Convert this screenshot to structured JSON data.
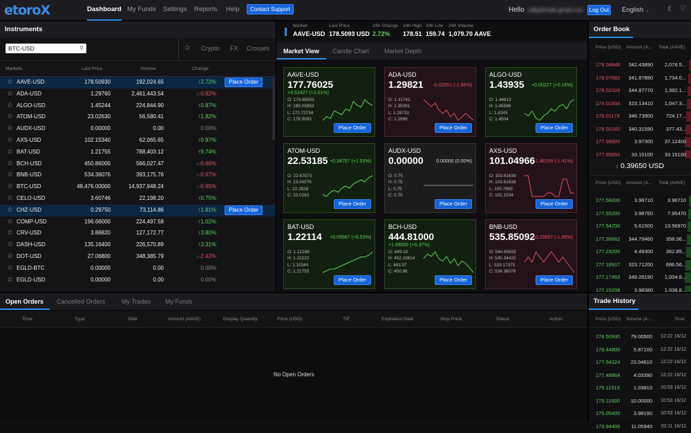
{
  "header": {
    "logo": "etoroX",
    "nav": [
      {
        "label": "Dashboard",
        "active": true
      },
      {
        "label": "My Funds",
        "active": false
      },
      {
        "label": "Settings",
        "active": false
      },
      {
        "label": "Reports",
        "active": false
      },
      {
        "label": "Help",
        "active": false
      }
    ],
    "contact_support": "Contact Support",
    "greeting": "Hello",
    "user_email": "sdfg@trade.gmail.com",
    "logout": "Log Out",
    "language": "English"
  },
  "instruments": {
    "title": "Instruments",
    "search_value": "BTC-USD",
    "filter_tabs": [
      "Crypto",
      "FX",
      "Crosses"
    ],
    "columns": [
      "Markets",
      "Last Price",
      "Volume",
      "Change"
    ],
    "place_order_label": "Place Order",
    "rows": [
      {
        "market": "AAVE-USD",
        "last": "178.50930",
        "volume": "192,024.65",
        "change": "2.72%",
        "dir": "up",
        "selected": true
      },
      {
        "market": "ADA-USD",
        "last": "1.29760",
        "volume": "2,461,443.54",
        "change": "-0.92%",
        "dir": "dn",
        "selected": false
      },
      {
        "market": "ALGO-USD",
        "last": "1.45244",
        "volume": "224,844.90",
        "change": "0.87%",
        "dir": "up",
        "selected": false
      },
      {
        "market": "ATOM-USD",
        "last": "23.02630",
        "volume": "56,580.41",
        "change": "1.82%",
        "dir": "up",
        "selected": false
      },
      {
        "market": "AUDX-USD",
        "last": "0.00000",
        "volume": "0.00",
        "change": "0.00%",
        "dir": "ne",
        "selected": false
      },
      {
        "market": "AXS-USD",
        "last": "102.15340",
        "volume": "62,065.65",
        "change": "0.97%",
        "dir": "up",
        "selected": false
      },
      {
        "market": "BAT-USD",
        "last": "1.21755",
        "volume": "788,403.12",
        "change": "9.74%",
        "dir": "up",
        "selected": false
      },
      {
        "market": "BCH-USD",
        "last": "450.86000",
        "volume": "566,027.47",
        "change": "-0.66%",
        "dir": "dn",
        "selected": false
      },
      {
        "market": "BNB-USD",
        "last": "534.36076",
        "volume": "393,175.76",
        "change": "-0.67%",
        "dir": "dn",
        "selected": false
      },
      {
        "market": "BTC-USD",
        "last": "48,476.00000",
        "volume": "14,937,948.24",
        "change": "-0.65%",
        "dir": "dn",
        "selected": false
      },
      {
        "market": "CELO-USD",
        "last": "3.60746",
        "volume": "22,198.20",
        "change": "0.75%",
        "dir": "up",
        "selected": false
      },
      {
        "market": "CHZ-USD",
        "last": "0.29750",
        "volume": "73,114.86",
        "change": "1.81%",
        "dir": "up",
        "selected": true
      },
      {
        "market": "COMP-USD",
        "last": "196.66000",
        "volume": "224,497.58",
        "change": "1.02%",
        "dir": "up",
        "selected": false
      },
      {
        "market": "CRV-USD",
        "last": "3.86820",
        "volume": "127,172.77",
        "change": "3.80%",
        "dir": "up",
        "selected": false
      },
      {
        "market": "DASH-USD",
        "last": "135.16400",
        "volume": "226,570.89",
        "change": "3.31%",
        "dir": "up",
        "selected": false
      },
      {
        "market": "DOT-USD",
        "last": "27.06800",
        "volume": "348,385.79",
        "change": "-2.42%",
        "dir": "dn",
        "selected": false
      },
      {
        "market": "EGLD-BTC",
        "last": "0.00000",
        "volume": "0.00",
        "change": "0.00%",
        "dir": "ne",
        "selected": false
      },
      {
        "market": "EGLD-USD",
        "last": "0.00000",
        "volume": "0.00",
        "change": "0.00%",
        "dir": "ne",
        "selected": false
      }
    ]
  },
  "market_bar": {
    "market_label": "Market",
    "market": "AAVE-USD",
    "last_label": "Last Price",
    "last": "178.5093 USD",
    "ch_label": "24h Change",
    "ch": "2.72%",
    "high_label": "24h High",
    "high": "178.51",
    "low_label": "24h Low",
    "low": "159.74",
    "vol_label": "24h Volume",
    "vol": "1,079.70 AAVE"
  },
  "center_tabs": [
    "Market View",
    "Candle Chart",
    "Market Depth"
  ],
  "cards": [
    {
      "sym": "AAVE-USD",
      "price": "177.76025",
      "change": "+3.52427 (+2.01%)",
      "o": "O: 174.98503",
      "h": "H: 180.03853",
      "l": "L: 172.72734",
      "c": "C: 178.5093",
      "tone": "g",
      "spark": [
        4,
        6,
        5,
        9,
        8,
        7,
        10,
        9,
        14,
        12,
        11,
        15,
        13,
        12
      ]
    },
    {
      "sym": "ADA-USD",
      "price": "1.29821",
      "change": "-0.02051 (-1.56%)",
      "o": "O: 1.31741",
      "h": "H: 1.35091",
      "l": "L: 1.28731",
      "c": "C: 1.2969",
      "tone": "r",
      "spark": [
        14,
        13,
        12,
        13,
        11,
        10,
        11,
        9,
        10,
        8,
        9,
        10,
        9,
        8
      ]
    },
    {
      "sym": "ALGO-USD",
      "price": "1.43935",
      "change": "+0.00227 (+0.16%)",
      "o": "O: 1.44813",
      "h": "H: 1.45596",
      "l": "L: 1.4245",
      "c": "C: 1.4504",
      "tone": "g",
      "spark": [
        8,
        7,
        9,
        6,
        5,
        7,
        8,
        10,
        9,
        11,
        12,
        10,
        13,
        14
      ]
    },
    {
      "sym": "ATOM-USD",
      "price": "22.53185",
      "change": "+0.34757 (+1.53%)",
      "o": "O: 22.67873",
      "h": "H: 23.04576",
      "l": "L: 22.2828",
      "c": "C: 23.0263",
      "tone": "g",
      "spark": [
        6,
        5,
        7,
        8,
        7,
        9,
        10,
        9,
        11,
        12,
        13,
        12,
        14,
        15
      ]
    },
    {
      "sym": "AUDX-USD",
      "price": "0.00000",
      "change": "0.00000 (0.00%)",
      "o": "O: 0.75",
      "h": "H: 0.75",
      "l": "L: 0.75",
      "c": "C: 0.75",
      "tone": "n",
      "spark": [
        8,
        8,
        8,
        8,
        8,
        8,
        8,
        8,
        8,
        8,
        8,
        8,
        8,
        8
      ]
    },
    {
      "sym": "AXS-USD",
      "price": "101.04966",
      "change": "-1.46299 (-1.41%)",
      "o": "O: 103.61639",
      "h": "H: 103.61639",
      "l": "L: 100.7969",
      "c": "C: 102.1534",
      "tone": "r",
      "spark": [
        14,
        14,
        8,
        8,
        8,
        8,
        9,
        9,
        8,
        8,
        13,
        13,
        9,
        9
      ]
    },
    {
      "sym": "BAT-USD",
      "price": "1.22114",
      "change": "+0.09567 (+8.53%)",
      "o": "O: 1.12188",
      "h": "H: 1.22122",
      "l": "L: 1.10344",
      "c": "C: 1.21755",
      "tone": "g",
      "spark": [
        3,
        4,
        5,
        5,
        6,
        7,
        8,
        9,
        10,
        11,
        12,
        12,
        13,
        15
      ]
    },
    {
      "sym": "BCH-USD",
      "price": "444.81000",
      "change": "+1.68000 (+0.37%)",
      "o": "O: 449.18",
      "h": "H: 452.10614",
      "l": "L: 443.37",
      "c": "C: 450.86",
      "tone": "g",
      "spark": [
        12,
        14,
        13,
        15,
        12,
        11,
        13,
        10,
        12,
        9,
        11,
        10,
        8,
        6
      ]
    },
    {
      "sym": "BNB-USD",
      "price": "535.85092",
      "change": "-10.29857 (-1.89%)",
      "o": "O: 544.65933",
      "h": "H: 545.34415",
      "l": "L: 529.17375",
      "c": "C: 534.36076",
      "tone": "r",
      "spark": [
        9,
        10,
        9,
        11,
        10,
        9,
        10,
        11,
        10,
        9,
        10,
        9,
        8,
        7
      ]
    }
  ],
  "order_book": {
    "title": "Order Book",
    "columns": [
      "Price (USD)",
      "Amount (A...",
      "Total (AAVE)"
    ],
    "asks": [
      {
        "p": "178.08848",
        "a": "342.43890",
        "t": "2,076.5..."
      },
      {
        "p": "178.07682",
        "a": "341.87890",
        "t": "1,734.0..."
      },
      {
        "p": "178.02326",
        "a": "344.87770",
        "t": "1,392.1..."
      },
      {
        "p": "178.01934",
        "a": "323.13410",
        "t": "1,047.3..."
      },
      {
        "p": "178.01178",
        "a": "346.73900",
        "t": "724.17..."
      },
      {
        "p": "178.00182",
        "a": "340.31590",
        "t": "377.43..."
      },
      {
        "p": "177.98800",
        "a": "3.97300",
        "t": "37.12400"
      },
      {
        "p": "177.95850",
        "a": "33.15100",
        "t": "33.15100"
      }
    ],
    "spread": "0.39650 USD",
    "bids": [
      {
        "p": "177.56000",
        "a": "3.96710",
        "t": "3.96710"
      },
      {
        "p": "177.55200",
        "a": "3.98760",
        "t": "7.95470"
      },
      {
        "p": "177.54200",
        "a": "5.61500",
        "t": "13.56970"
      },
      {
        "p": "177.36662",
        "a": "344.79460",
        "t": "358.36..."
      },
      {
        "p": "177.19200",
        "a": "4.49300",
        "t": "362.85..."
      },
      {
        "p": "177.18917",
        "a": "323.71200",
        "t": "686.56..."
      },
      {
        "p": "177.17453",
        "a": "348.26190",
        "t": "1,034.8..."
      },
      {
        "p": "177.15208",
        "a": "3.98380",
        "t": "1,038.8..."
      }
    ]
  },
  "orders": {
    "tabs": [
      "Open Orders",
      "Cancelled Orders",
      "My Trades",
      "My Funds"
    ],
    "columns": [
      "Time",
      "Type",
      "Side",
      "Amount (AAVE)",
      "Display Quantity",
      "Price (USD)",
      "TIF",
      "Expiration Date",
      "Stop Price",
      "Status",
      "Action"
    ],
    "empty": "No Open Orders"
  },
  "trade_history": {
    "title": "Trade History",
    "columns": [
      "Price (USD)",
      "Volume (A...",
      "Time"
    ],
    "rows": [
      {
        "p": "178.50930",
        "v": "79.00500",
        "t": "12:22 16/12"
      },
      {
        "p": "178.44800",
        "v": "5.87100",
        "t": "12:22 16/12"
      },
      {
        "p": "177.54324",
        "v": "23.04610",
        "t": "12:22 16/12"
      },
      {
        "p": "177.48864",
        "v": "4.03390",
        "t": "12:22 16/12"
      },
      {
        "p": "175.11519",
        "v": "1.03810",
        "t": "10:53 16/12"
      },
      {
        "p": "175.11500",
        "v": "10.00000",
        "t": "10:53 16/12"
      },
      {
        "p": "175.05400",
        "v": "3.98190",
        "t": "10:53 16/12"
      },
      {
        "p": "173.94400",
        "v": "11.05940",
        "t": "03:11 16/12"
      }
    ]
  },
  "colors": {
    "accent": "#2f8de4",
    "up": "#5ed15b",
    "down": "#e8505b",
    "ask": "#e8505b",
    "bid": "#5ed15b"
  }
}
